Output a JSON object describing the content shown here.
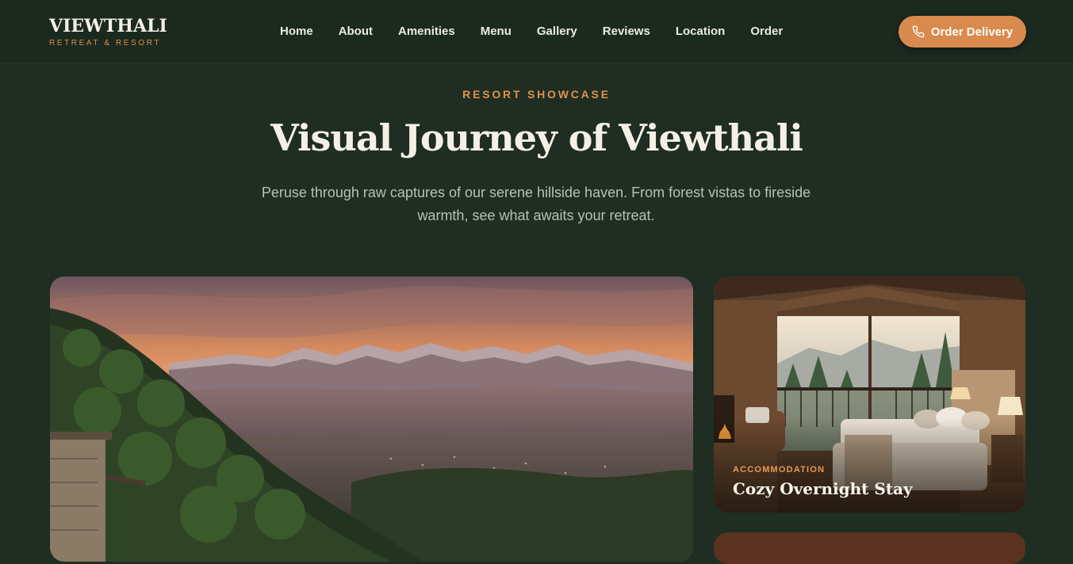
{
  "brand": {
    "name": "VIEWTHALI",
    "tagline": "RETREAT & RESORT"
  },
  "nav": {
    "items": [
      "Home",
      "About",
      "Amenities",
      "Menu",
      "Gallery",
      "Reviews",
      "Location",
      "Order"
    ]
  },
  "header": {
    "cta_label": "Order Delivery",
    "cta_icon": "phone-icon"
  },
  "hero": {
    "eyebrow": "RESORT SHOWCASE",
    "title": "Visual Journey of Viewthali",
    "subtitle": "Peruse through raw captures of our serene hillside haven. From forest vistas to fireside warmth, see what awaits your retreat."
  },
  "gallery": {
    "items": [
      {
        "label": "",
        "title": ""
      },
      {
        "label": "ACCOMMODATION",
        "title": "Cozy Overnight Stay"
      }
    ]
  },
  "colors": {
    "background": "#1f2d22",
    "accent": "#d98a4e",
    "header": "#1c291e"
  }
}
